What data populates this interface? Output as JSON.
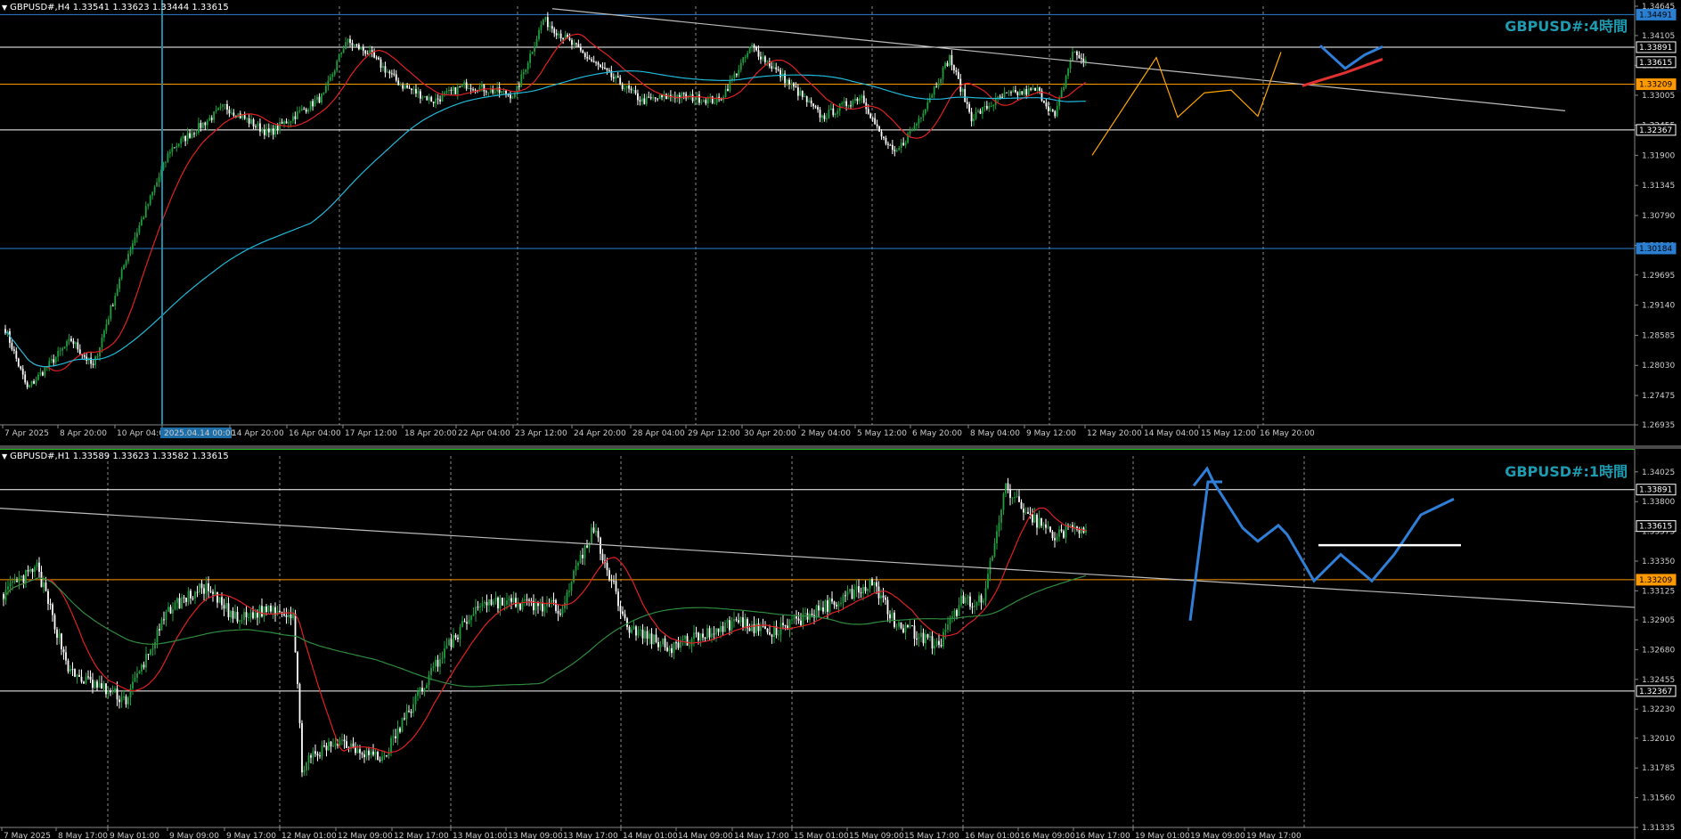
{
  "window": {
    "h4": {
      "info": "GBPUSD#,H4  1.33541 1.33623 1.33444 1.33615",
      "watermark": "GBPUSD#:4時間",
      "axis_ticks": [
        1.34645,
        1.34105,
        1.33555,
        1.33005,
        1.32455,
        1.319,
        1.31345,
        1.3079,
        1.3024,
        1.29695,
        1.2914,
        1.28585,
        1.2803,
        1.27475,
        1.26935
      ],
      "level_labels": [
        {
          "value": 1.34491,
          "text": "1.34491",
          "color": "#2a7fd1"
        },
        {
          "value": 1.33891,
          "text": "1.33891",
          "color": "#ffffff"
        },
        {
          "value": 1.33615,
          "text": "1.33615",
          "color": "#ffffff"
        },
        {
          "value": 1.33209,
          "text": "1.33209",
          "color": "#ff9900"
        },
        {
          "value": 1.32367,
          "text": "1.32367",
          "color": "#ffffff"
        },
        {
          "value": 1.30184,
          "text": "1.30184",
          "color": "#2a7fd1"
        }
      ],
      "time_labels": [
        "7 Apr 2025",
        "8 Apr 20:00",
        "10 Apr 04:00",
        "2025.04.14 00:00",
        "14 Apr 20:00",
        "16 Apr 04:00",
        "17 Apr 12:00",
        "18 Apr 20:00",
        "22 Apr 04:00",
        "23 Apr 12:00",
        "24 Apr 20:00",
        "28 Apr 04:00",
        "29 Apr 12:00",
        "30 Apr 20:00",
        "2 May 04:00",
        "5 May 12:00",
        "6 May 20:00",
        "8 May 04:00",
        "9 May 12:00",
        "12 May 20:00",
        "14 May 04:00",
        "15 May 12:00",
        "16 May 20:00"
      ],
      "crosshair_label": "2025.04.14 00:00"
    },
    "h1": {
      "info": "GBPUSD#,H1  1.33589 1.33623 1.33582 1.33615",
      "watermark": "GBPUSD#:1時間",
      "axis_ticks": [
        1.34025,
        1.338,
        1.33575,
        1.3335,
        1.33125,
        1.32905,
        1.3268,
        1.32455,
        1.3223,
        1.3201,
        1.31785,
        1.3156,
        1.31335
      ],
      "level_labels": [
        {
          "value": 1.33891,
          "text": "1.33891",
          "color": "#ffffff"
        },
        {
          "value": 1.33615,
          "text": "1.33615",
          "color": "#ffffff"
        },
        {
          "value": 1.33209,
          "text": "1.33209",
          "color": "#ff9900"
        },
        {
          "value": 1.32367,
          "text": "1.32367",
          "color": "#ffffff"
        }
      ],
      "time_labels": [
        "7 May 2025",
        "8 May 17:00",
        "9 May 01:00",
        "9 May 09:00",
        "9 May 17:00",
        "12 May 01:00",
        "12 May 09:00",
        "12 May 17:00",
        "13 May 01:00",
        "13 May 09:00",
        "13 May 17:00",
        "14 May 01:00",
        "14 May 09:00",
        "14 May 17:00",
        "15 May 01:00",
        "15 May 09:00",
        "15 May 17:00",
        "16 May 01:00",
        "16 May 09:00",
        "16 May 17:00",
        "19 May 01:00",
        "19 May 09:00",
        "19 May 17:00"
      ]
    }
  },
  "colors": {
    "bull": "#1f9e3f",
    "bear": "#ffffff",
    "ma_fast": "#e02020",
    "ma_slow_h4": "#20b8d8",
    "ma_slow_h1": "#2e8b3e",
    "level_blue": "#2a7fd1",
    "level_orange": "#ff9900",
    "forecast": "#2f7fd8",
    "trend": "#bbbbbb"
  },
  "chart_data": [
    {
      "type": "candlestick",
      "symbol": "GBPUSD#",
      "timeframe": "H4",
      "ylim": [
        1.26935,
        1.34645
      ],
      "waypoints": [
        [
          0,
          1.287
        ],
        [
          10,
          1.276
        ],
        [
          30,
          1.285
        ],
        [
          40,
          1.28
        ],
        [
          55,
          1.3
        ],
        [
          75,
          1.32
        ],
        [
          100,
          1.328
        ],
        [
          120,
          1.323
        ],
        [
          145,
          1.33
        ],
        [
          155,
          1.34
        ],
        [
          165,
          1.338
        ],
        [
          180,
          1.332
        ],
        [
          195,
          1.329
        ],
        [
          210,
          1.332
        ],
        [
          232,
          1.33
        ],
        [
          245,
          1.344
        ],
        [
          265,
          1.337
        ],
        [
          290,
          1.329
        ],
        [
          305,
          1.33
        ],
        [
          325,
          1.329
        ],
        [
          340,
          1.339
        ],
        [
          360,
          1.331
        ],
        [
          372,
          1.326
        ],
        [
          390,
          1.33
        ],
        [
          398,
          1.323
        ],
        [
          405,
          1.319
        ],
        [
          415,
          1.325
        ],
        [
          430,
          1.337
        ],
        [
          440,
          1.326
        ],
        [
          455,
          1.33
        ],
        [
          470,
          1.331
        ],
        [
          478,
          1.326
        ],
        [
          486,
          1.338
        ],
        [
          492,
          1.3362
        ]
      ],
      "horizontal_levels": [
        1.34491,
        1.33891,
        1.33209,
        1.32367,
        1.30184
      ]
    },
    {
      "type": "candlestick",
      "symbol": "GBPUSD#",
      "timeframe": "H1",
      "ylim": [
        1.31335,
        1.34145
      ],
      "waypoints": [
        [
          0,
          1.331
        ],
        [
          15,
          1.333
        ],
        [
          30,
          1.325
        ],
        [
          55,
          1.323
        ],
        [
          75,
          1.33
        ],
        [
          90,
          1.3315
        ],
        [
          105,
          1.329
        ],
        [
          120,
          1.33
        ],
        [
          130,
          1.3295
        ],
        [
          134,
          1.318
        ],
        [
          150,
          1.32
        ],
        [
          170,
          1.3185
        ],
        [
          195,
          1.326
        ],
        [
          215,
          1.3305
        ],
        [
          250,
          1.33
        ],
        [
          265,
          1.336
        ],
        [
          280,
          1.3285
        ],
        [
          300,
          1.327
        ],
        [
          330,
          1.329
        ],
        [
          345,
          1.328
        ],
        [
          380,
          1.331
        ],
        [
          390,
          1.332
        ],
        [
          400,
          1.329
        ],
        [
          420,
          1.327
        ],
        [
          430,
          1.3305
        ],
        [
          440,
          1.3305
        ],
        [
          450,
          1.339
        ],
        [
          460,
          1.337
        ],
        [
          472,
          1.3355
        ],
        [
          486,
          1.3362
        ]
      ],
      "horizontal_levels": [
        1.33891,
        1.33209,
        1.32367
      ]
    }
  ]
}
